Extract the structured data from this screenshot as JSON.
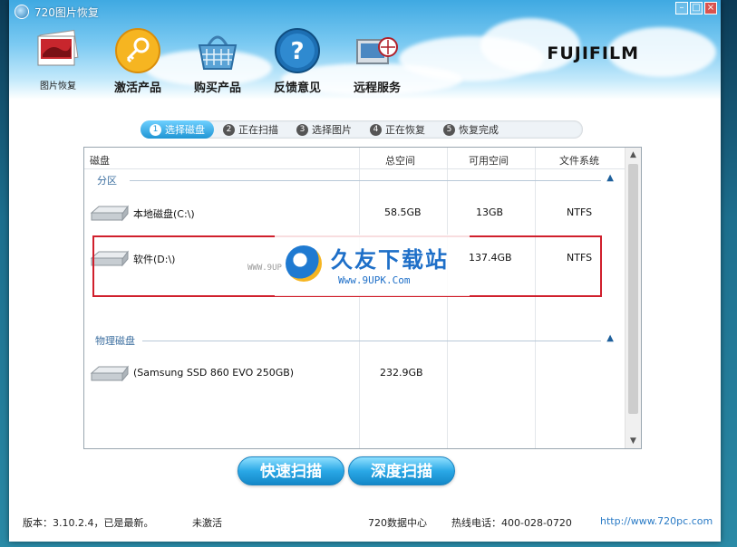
{
  "window": {
    "title": "720图片恢复"
  },
  "toolbar": {
    "items": [
      {
        "label": "图片恢复",
        "icon": "photo-icon"
      },
      {
        "label": "激活产品",
        "icon": "key-icon"
      },
      {
        "label": "购买产品",
        "icon": "basket-icon"
      },
      {
        "label": "反馈意见",
        "icon": "help-icon"
      },
      {
        "label": "远程服务",
        "icon": "remote-service-icon"
      }
    ]
  },
  "brand": "FUJIFILM",
  "steps": [
    {
      "num": "1",
      "label": "选择磁盘",
      "active": true
    },
    {
      "num": "2",
      "label": "正在扫描",
      "active": false
    },
    {
      "num": "3",
      "label": "选择图片",
      "active": false
    },
    {
      "num": "4",
      "label": "正在恢复",
      "active": false
    },
    {
      "num": "5",
      "label": "恢复完成",
      "active": false
    }
  ],
  "table": {
    "headers": {
      "disk": "磁盘",
      "total": "总空间",
      "free": "可用空间",
      "fs": "文件系统"
    },
    "group_partition": "分区",
    "group_physical": "物理磁盘",
    "partitions": [
      {
        "name": "本地磁盘(C:\\)",
        "total": "58.5GB",
        "free": "13GB",
        "fs": "NTFS"
      },
      {
        "name": "软件(D:\\)",
        "total": "",
        "free": "137.4GB",
        "fs": "NTFS"
      }
    ],
    "physical": [
      {
        "name": "(Samsung SSD 860 EVO 250GB)",
        "total": "232.9GB",
        "free": "",
        "fs": ""
      }
    ]
  },
  "watermark": {
    "title": "久友下载站",
    "url": "Www.9UPK.Com",
    "left_text": "WWW.9UP"
  },
  "buttons": {
    "quick_scan": "快速扫描",
    "deep_scan": "深度扫描"
  },
  "status": {
    "version": "版本：3.10.2.4，已是最新。",
    "activation": "未激活",
    "data_center": "720数据中心",
    "hotline": "热线电话：400-028-0720",
    "website": "http://www.720pc.com"
  },
  "colors": {
    "accent": "#1f95d4",
    "highlight": "#d01f2c"
  }
}
